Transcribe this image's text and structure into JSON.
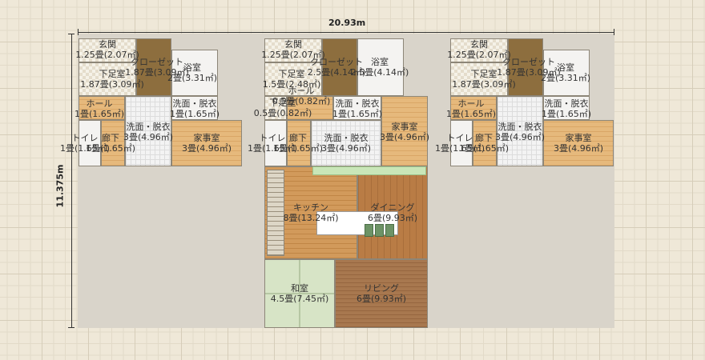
{
  "dimensions": {
    "width_label": "20.93m",
    "height_label": "11.375m"
  },
  "rooms": [
    {
      "id": "u1-genkan",
      "name": "玄関",
      "area": "1.25畳(2.07㎡)"
    },
    {
      "id": "u1-closet",
      "name": "クローゼット",
      "area": "1.87畳(3.09㎡)"
    },
    {
      "id": "u1-bath",
      "name": "浴室",
      "area": "2畳(3.31㎡)"
    },
    {
      "id": "u1-shoes",
      "name": "下足室",
      "area": "1.87畳(3.09㎡)"
    },
    {
      "id": "u1-hall",
      "name": "ホール",
      "area": "1畳(1.65㎡)"
    },
    {
      "id": "u1-wash1",
      "name": "洗面・脱衣",
      "area": "1畳(1.65㎡)"
    },
    {
      "id": "u1-wash2",
      "name": "洗面・脱衣",
      "area": "3畳(4.96㎡)"
    },
    {
      "id": "u1-utility",
      "name": "家事室",
      "area": "3畳(4.96㎡)"
    },
    {
      "id": "u1-toilet",
      "name": "トイレ",
      "area": "1畳(1.65㎡)"
    },
    {
      "id": "u1-corridor",
      "name": "廊下",
      "area": "1畳(1.65㎡)"
    },
    {
      "id": "u2-genkan",
      "name": "玄関",
      "area": "1.25畳(2.07㎡)"
    },
    {
      "id": "u2-closet",
      "name": "クローゼット",
      "area": "2.5畳(4.14㎡)"
    },
    {
      "id": "u2-bath",
      "name": "浴室",
      "area": "2.5畳(4.14㎡)"
    },
    {
      "id": "u2-shoes",
      "name": "下足室",
      "area": "1.5畳(2.48㎡)"
    },
    {
      "id": "u2-hall",
      "name": "ホール",
      "area": "0.5畳(0.82㎡)"
    },
    {
      "id": "u2-shoes2",
      "name": "下足室",
      "area": "0.5畳(0.82㎡)"
    },
    {
      "id": "u2-wash1",
      "name": "洗面・脱衣",
      "area": "1畳(1.65㎡)"
    },
    {
      "id": "u2-utility",
      "name": "家事室",
      "area": "3畳(4.96㎡)"
    },
    {
      "id": "u2-toilet",
      "name": "トイレ",
      "area": "1畳(1.65㎡)"
    },
    {
      "id": "u2-corridor",
      "name": "廊下",
      "area": "1畳(1.65㎡)"
    },
    {
      "id": "u2-wash2",
      "name": "洗面・脱衣",
      "area": "3畳(4.96㎡)"
    },
    {
      "id": "u2-kitchen",
      "name": "キッチン",
      "area": "8畳(13.24㎡)"
    },
    {
      "id": "u2-dining",
      "name": "ダイニング",
      "area": "6畳(9.93㎡)"
    },
    {
      "id": "u2-washitsu",
      "name": "和室",
      "area": "4.5畳(7.45㎡)"
    },
    {
      "id": "u2-living",
      "name": "リビング",
      "area": "6畳(9.93㎡)"
    },
    {
      "id": "u3-genkan",
      "name": "玄関",
      "area": "1.25畳(2.07㎡)"
    },
    {
      "id": "u3-closet",
      "name": "クローゼット",
      "area": "1.87畳(3.09㎡)"
    },
    {
      "id": "u3-bath",
      "name": "浴室",
      "area": "2畳(3.31㎡)"
    },
    {
      "id": "u3-shoes",
      "name": "下足室",
      "area": "1.87畳(3.09㎡)"
    },
    {
      "id": "u3-hall",
      "name": "ホール",
      "area": "1畳(1.65㎡)"
    },
    {
      "id": "u3-wash1",
      "name": "洗面・脱衣",
      "area": "1畳(1.65㎡)"
    },
    {
      "id": "u3-wash2",
      "name": "洗面・脱衣",
      "area": "3畳(4.96㎡)"
    },
    {
      "id": "u3-utility",
      "name": "家事室",
      "area": "3畳(4.96㎡)"
    },
    {
      "id": "u3-toilet",
      "name": "トイレ",
      "area": "1畳(1.65㎡)"
    },
    {
      "id": "u3-corridor",
      "name": "廊下",
      "area": "1畳(1.65㎡)"
    }
  ]
}
